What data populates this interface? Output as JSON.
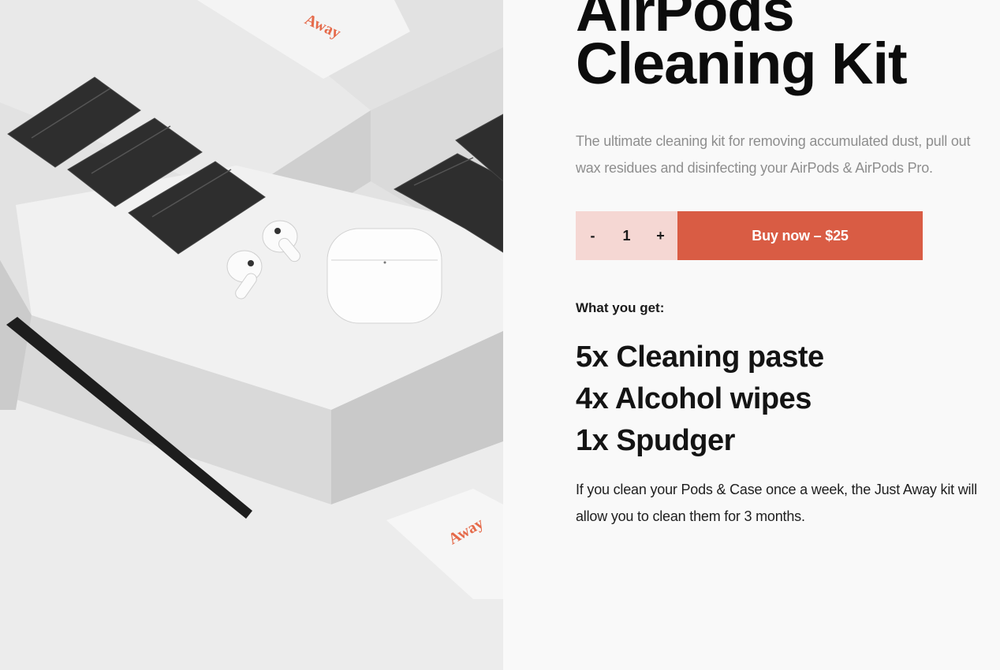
{
  "product": {
    "title_line1": "AirPods",
    "title_line2": "Cleaning Kit",
    "description": "The ultimate cleaning kit for removing accumulated dust, pull out wax residues and disinfecting your AirPods & AirPods Pro."
  },
  "purchase": {
    "decrement_label": "-",
    "quantity": "1",
    "increment_label": "+",
    "buy_label": "Buy now – $25"
  },
  "contents": {
    "heading": "What you get:",
    "items": [
      {
        "label": "5x Cleaning paste"
      },
      {
        "label": "4x Alcohol wipes"
      },
      {
        "label": "1x Spudger"
      }
    ]
  },
  "note": "If you clean your Pods & Case once a week, the Just Away kit will allow you to clean them for 3 months.",
  "image": {
    "brand_mark_top": "Away",
    "brand_mark_bottom": "Away"
  },
  "colors": {
    "accent": "#d95c44",
    "quantity_bg": "#f5d7d3",
    "page_bg": "#f9f9f9",
    "muted_text": "#8e8e8e"
  }
}
